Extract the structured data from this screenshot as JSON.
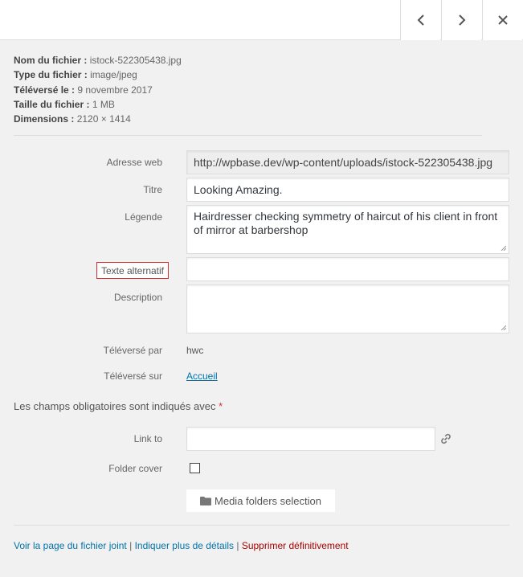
{
  "nav": {
    "prev_icon": "chevron-left-icon",
    "next_icon": "chevron-right-icon",
    "close_icon": "close-icon"
  },
  "details": [
    {
      "label": "Nom du fichier :",
      "value": "istock-522305438.jpg"
    },
    {
      "label": "Type du fichier :",
      "value": "image/jpeg"
    },
    {
      "label": "Téléversé le :",
      "value": "9 novembre 2017"
    },
    {
      "label": "Taille du fichier :",
      "value": "1 MB"
    },
    {
      "label": "Dimensions :",
      "value": "2120 × 1414"
    }
  ],
  "form": {
    "url_label": "Adresse web",
    "url_value": "http://wpbase.dev/wp-content/uploads/istock-522305438.jpg",
    "title_label": "Titre",
    "title_value": "Looking Amazing.",
    "caption_label": "Légende",
    "caption_value": "Hairdresser checking symmetry of haircut of his client in front of mirror at barbershop",
    "alt_label": "Texte alternatif",
    "alt_value": "",
    "description_label": "Description",
    "description_value": "",
    "uploaded_by_label": "Téléversé par",
    "uploaded_by_value": "hwc",
    "uploaded_to_label": "Téléversé sur",
    "uploaded_to_value": "Accueil",
    "required_note": "Les champs obligatoires sont indiqués avec",
    "required_star": "*",
    "link_to_label": "Link to",
    "link_to_value": "",
    "folder_cover_label": "Folder cover",
    "folder_cover_checked": false,
    "media_folders_button": "Media folders selection"
  },
  "actions": {
    "view": "Voir la page du fichier joint",
    "edit": "Indiquer plus de détails",
    "delete": "Supprimer définitivement",
    "separator": "|"
  },
  "colors": {
    "link": "#0073aa",
    "delete": "#aa0000",
    "highlight_border": "#d32f2f"
  }
}
